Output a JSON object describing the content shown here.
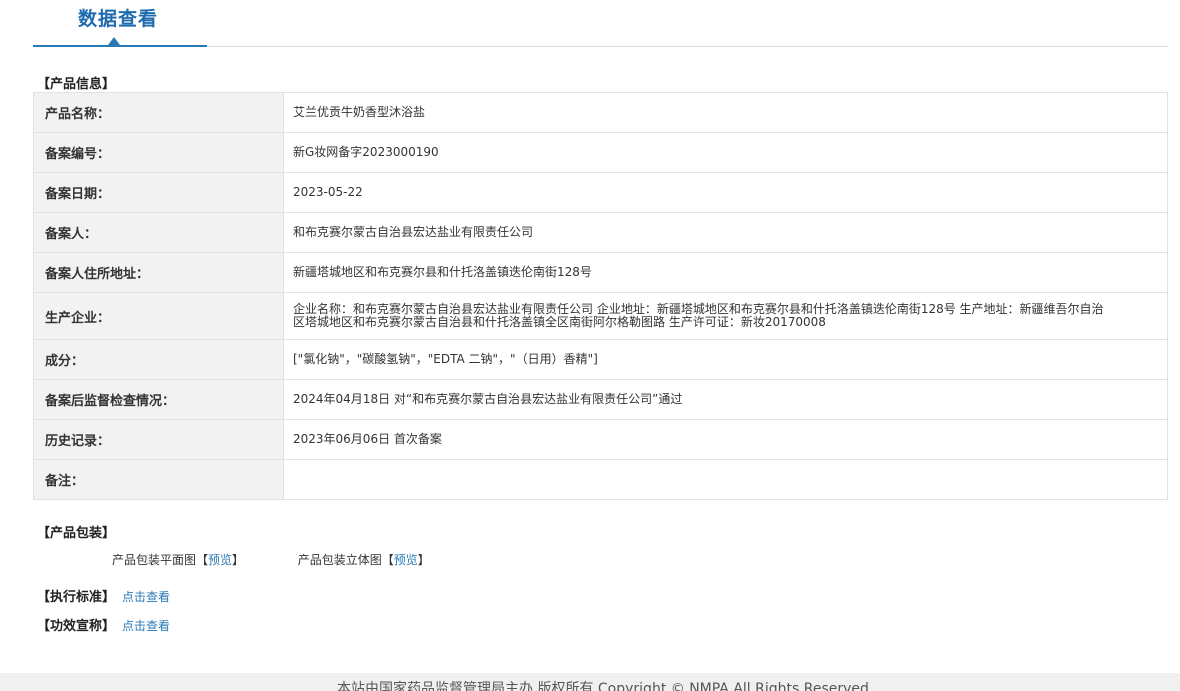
{
  "header": {
    "title": "数据查看"
  },
  "sections": {
    "product_info": "【产品信息】",
    "packaging": "【产品包装】",
    "standard": "【执行标准】",
    "efficacy": "【功效宣称】"
  },
  "rows": [
    {
      "label": "产品名称：",
      "value": "艾兰优贡牛奶香型沐浴盐"
    },
    {
      "label": "备案编号：",
      "value": "新G妆网备字2023000190"
    },
    {
      "label": "备案日期：",
      "value": "2023-05-22"
    },
    {
      "label": "备案人：",
      "value": "和布克赛尔蒙古自治县宏达盐业有限责任公司"
    },
    {
      "label": "备案人住所地址：",
      "value": "新疆塔城地区和布克赛尔县和什托洛盖镇迭伦南街128号"
    },
    {
      "label": "生产企业：",
      "value": "企业名称：和布克赛尔蒙古自治县宏达盐业有限责任公司 企业地址：新疆塔城地区和布克赛尔县和什托洛盖镇迭伦南街128号 生产地址：新疆维吾尔自治区塔城地区和布克赛尔蒙古自治县和什托洛盖镇全区南街阿尔格勒图路 生产许可证：新妆20170008"
    },
    {
      "label": "成分：",
      "value": "[\"氯化钠\"，\"碳酸氢钠\"，\"EDTA 二钠\"，\"（日用）香精\"]"
    },
    {
      "label": "备案后监督检查情况：",
      "value": "2024年04月18日 对“和布克赛尔蒙古自治县宏达盐业有限责任公司”通过"
    },
    {
      "label": "历史记录：",
      "value": "2023年06月06日 首次备案"
    },
    {
      "label": "备注：",
      "value": ""
    }
  ],
  "packaging": {
    "flat_label": "产品包装平面图",
    "flat_open": "【",
    "flat_link": "预览",
    "flat_close": "】",
    "solid_label": "产品包装立体图 ",
    "solid_open": "【",
    "solid_link": "预览",
    "solid_close": "】"
  },
  "standard": {
    "link": "点击查看"
  },
  "efficacy": {
    "link": "点击查看"
  },
  "footer": {
    "text": "本站由国家药品监督管理局主办 版权所有 Copyright © NMPA All Rights Reserved"
  }
}
